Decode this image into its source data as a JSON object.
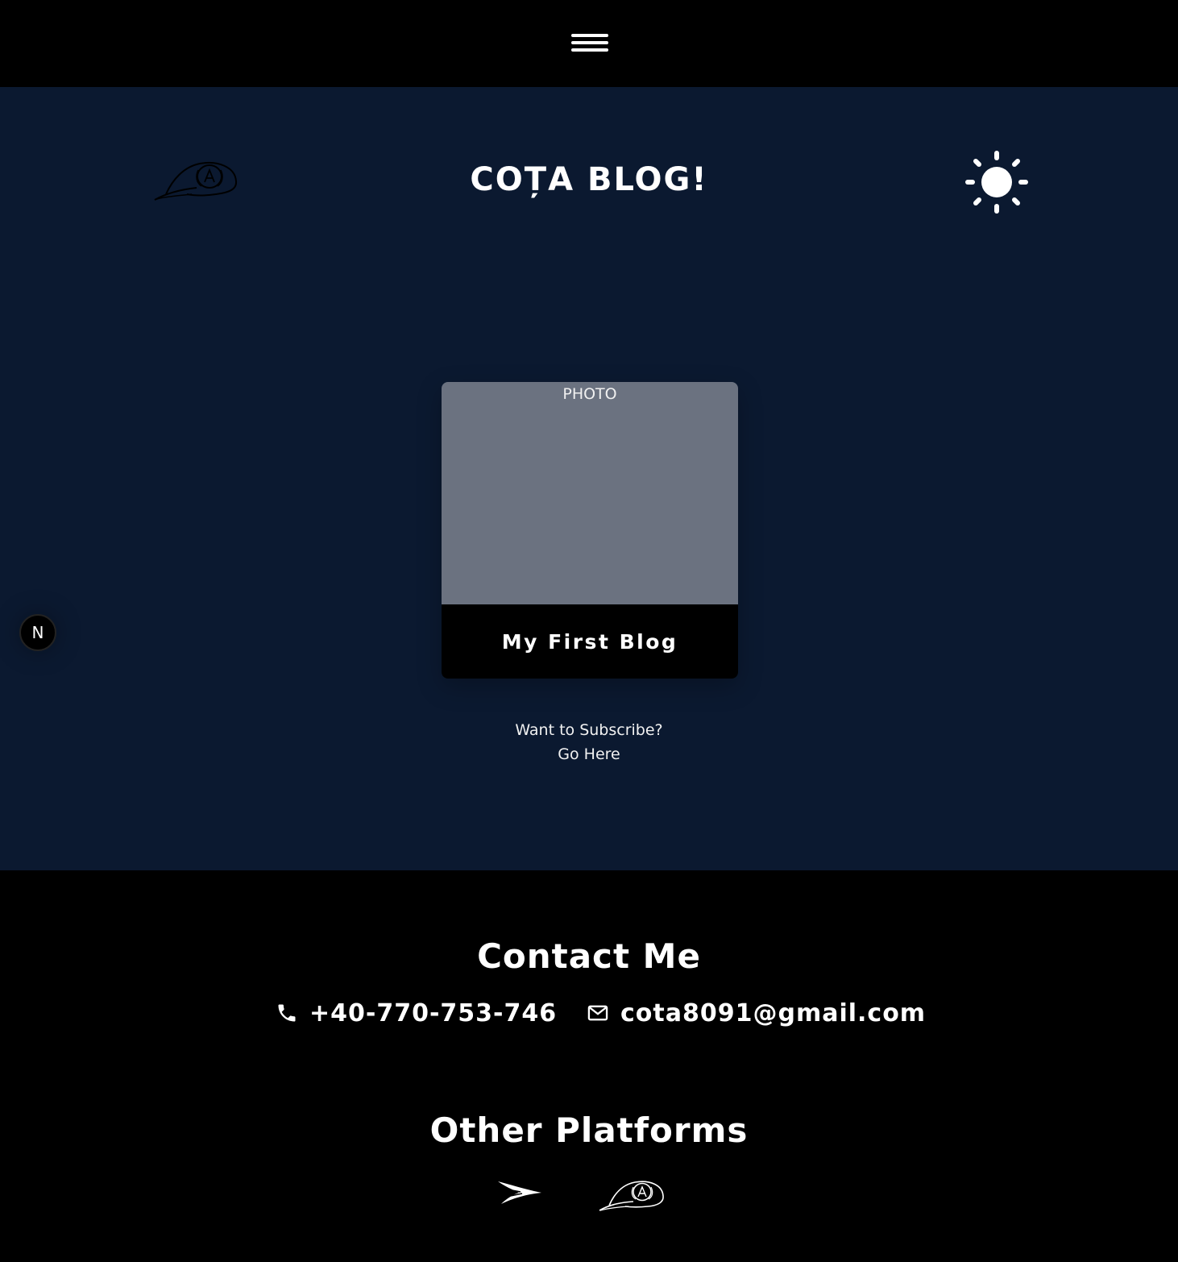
{
  "header": {
    "menu_icon": "hamburger-menu-icon"
  },
  "hero": {
    "title": "COȚA BLOG!",
    "logo_icon": "baseball-cap-logo-icon",
    "theme_icon": "sun-icon"
  },
  "card": {
    "photo_label": "PHOTO",
    "title": "My First Blog",
    "photo_color": "#6b7280"
  },
  "subscribe": {
    "line1": "Want to Subscribe?",
    "line2": "Go Here"
  },
  "badge": {
    "label": "N"
  },
  "footer": {
    "contact_heading": "Contact Me",
    "phone": "+40-770-753-746",
    "email": "cota8091@gmail.com",
    "platforms_heading": "Other Platforms"
  },
  "colors": {
    "main_bg": "#0b1930",
    "bar_bg": "#000000",
    "text": "#ffffff"
  }
}
